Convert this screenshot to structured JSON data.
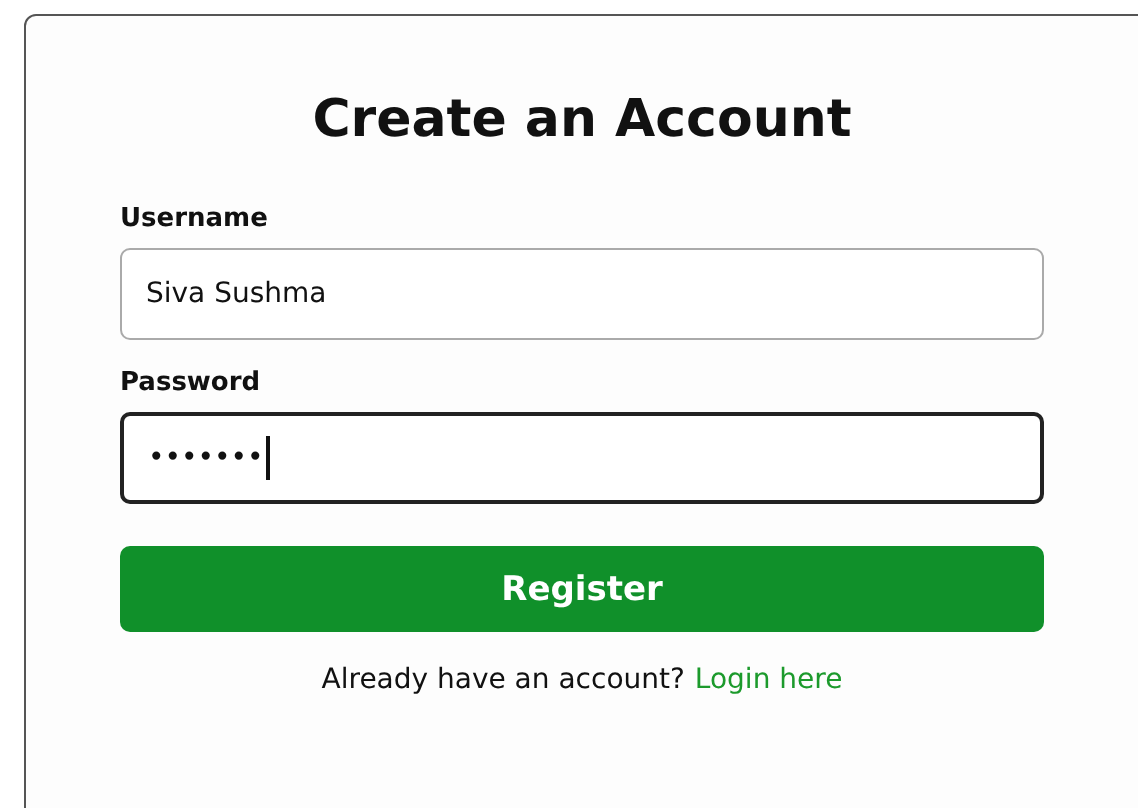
{
  "title": "Create an Account",
  "fields": [
    {
      "label": "Username",
      "value": "Siva Sushma",
      "focused": false
    },
    {
      "label": "Password",
      "value": "•••••••",
      "focused": true
    }
  ],
  "submit_button": "Register",
  "footer": {
    "text": "Already have an account?",
    "link": "Login here"
  }
}
